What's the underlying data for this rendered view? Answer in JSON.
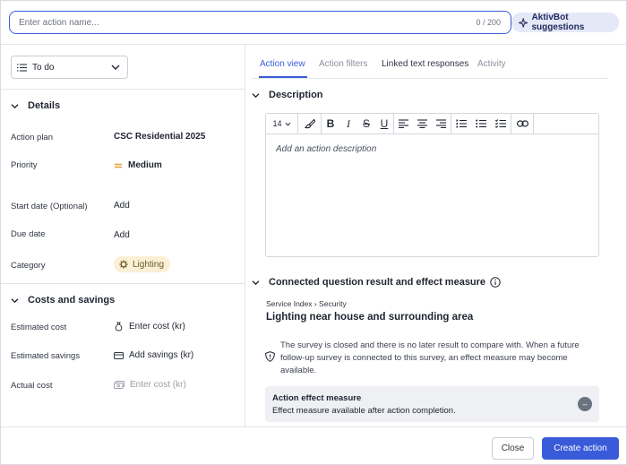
{
  "header": {
    "name_placeholder": "Enter action name...",
    "name_value": "",
    "char_counter": "0 / 200",
    "aktivbot_label": "AktivBot suggestions"
  },
  "status": {
    "selected": "To do"
  },
  "details": {
    "title": "Details",
    "rows": [
      {
        "label": "Action plan",
        "value": "CSC Residential 2025"
      },
      {
        "label": "Priority",
        "value": "Medium"
      },
      {
        "label": "Start date (Optional)",
        "value": "Add"
      },
      {
        "label": "Due date",
        "value": "Add"
      },
      {
        "label": "Category",
        "value": "Lighting"
      }
    ]
  },
  "costs": {
    "title": "Costs and savings",
    "rows": [
      {
        "label": "Estimated cost",
        "value": "Enter cost (kr)"
      },
      {
        "label": "Estimated savings",
        "value": "Add savings (kr)"
      },
      {
        "label": "Actual cost",
        "value": "Enter cost (kr)"
      }
    ]
  },
  "tabs": [
    {
      "label": "Action view"
    },
    {
      "label": "Action filters"
    },
    {
      "label": "Linked text responses"
    },
    {
      "label": "Activity"
    }
  ],
  "description": {
    "title": "Description",
    "font_size": "14",
    "placeholder": "Add an action description"
  },
  "connected": {
    "title": "Connected question result and effect measure",
    "breadcrumb": "Service Index › Security",
    "question": "Lighting near house and surrounding area",
    "note": "The survey is closed and there is no later result to compare with. When a future follow-up survey is connected to this survey, an effect measure may become available.",
    "effect_title": "Action effect measure",
    "effect_desc": "Effect measure available after action completion.",
    "effect_badge": "–"
  },
  "footer": {
    "close_label": "Close",
    "create_label": "Create action"
  },
  "colors": {
    "accent": "#3a5bd9",
    "priority": "#e0a43a",
    "category_chip_bg": "#fbf0d6"
  }
}
